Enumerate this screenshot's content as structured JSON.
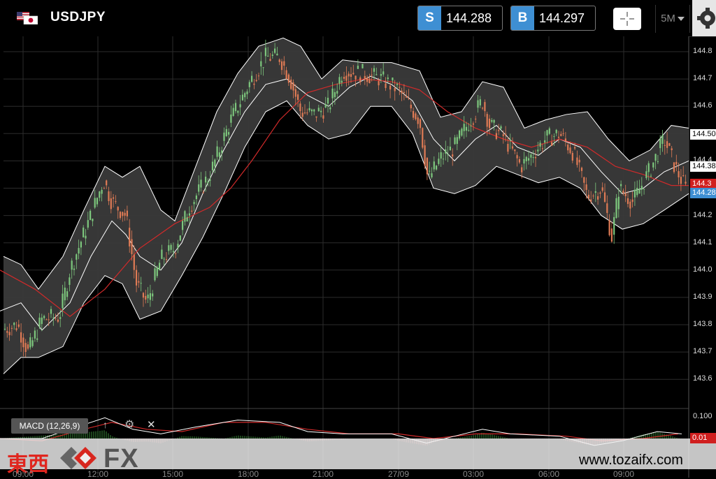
{
  "header": {
    "symbol": "USDJPY",
    "sell": {
      "tag": "S",
      "price": "144.288"
    },
    "buy": {
      "tag": "B",
      "price": "144.297"
    },
    "timeframe": "5M"
  },
  "price_badges": {
    "last": "144.50",
    "level2": "144.38",
    "red": "144.3",
    "blue": "144.28",
    "macd_red": "0.01"
  },
  "macd": {
    "label": "MACD (12,26,9)",
    "up_icon": "↑",
    "gear_icon": "⚙",
    "close_icon": "✕",
    "level_label": "0.100"
  },
  "watermark": {
    "kanji": "東西",
    "fx": "FX",
    "url": "www.tozaifx.com"
  },
  "colors": {
    "bull": "#7dc77d",
    "bear": "#e07b55",
    "band": "#ffffff",
    "ma": "#d02a2a",
    "badge_blue": "#3e8fd3"
  },
  "chart_data": {
    "type": "candlestick",
    "symbol": "USDJPY",
    "timeframe": "5M",
    "x_ticks": [
      "09:00",
      "12:00",
      "15:00",
      "18:00",
      "21:00",
      "27/09",
      "03:00",
      "06:00",
      "09:00"
    ],
    "y_ticks": [
      "144.8",
      "144.7",
      "144.6",
      "144.5",
      "144.4",
      "144.3",
      "144.2",
      "144.1",
      "144.0",
      "143.9",
      "143.8",
      "143.7",
      "143.6"
    ],
    "ylim": [
      143.55,
      144.85
    ],
    "grid": true,
    "price_series": [
      [
        0,
        143.78
      ],
      [
        25,
        143.8
      ],
      [
        40,
        143.7
      ],
      [
        60,
        143.82
      ],
      [
        85,
        143.83
      ],
      [
        100,
        144.0
      ],
      [
        130,
        144.2
      ],
      [
        148,
        144.33
      ],
      [
        160,
        144.25
      ],
      [
        180,
        144.2
      ],
      [
        195,
        143.95
      ],
      [
        210,
        143.88
      ],
      [
        230,
        144.04
      ],
      [
        250,
        144.08
      ],
      [
        270,
        144.23
      ],
      [
        300,
        144.35
      ],
      [
        330,
        144.55
      ],
      [
        360,
        144.7
      ],
      [
        380,
        144.78
      ],
      [
        400,
        144.78
      ],
      [
        415,
        144.7
      ],
      [
        430,
        144.58
      ],
      [
        450,
        144.57
      ],
      [
        470,
        144.6
      ],
      [
        490,
        144.73
      ],
      [
        520,
        144.72
      ],
      [
        545,
        144.7
      ],
      [
        570,
        144.66
      ],
      [
        600,
        144.55
      ],
      [
        612,
        144.33
      ],
      [
        630,
        144.41
      ],
      [
        650,
        144.45
      ],
      [
        670,
        144.54
      ],
      [
        690,
        144.62
      ],
      [
        700,
        144.53
      ],
      [
        720,
        144.49
      ],
      [
        745,
        144.38
      ],
      [
        760,
        144.42
      ],
      [
        780,
        144.48
      ],
      [
        800,
        144.5
      ],
      [
        820,
        144.43
      ],
      [
        840,
        144.27
      ],
      [
        860,
        144.3
      ],
      [
        875,
        144.12
      ],
      [
        885,
        144.3
      ],
      [
        905,
        144.25
      ],
      [
        930,
        144.37
      ],
      [
        950,
        144.48
      ],
      [
        965,
        144.38
      ],
      [
        980,
        144.3
      ]
    ],
    "ma_line": [
      [
        0,
        144.0
      ],
      [
        50,
        143.93
      ],
      [
        100,
        143.83
      ],
      [
        150,
        143.93
      ],
      [
        200,
        144.08
      ],
      [
        250,
        144.17
      ],
      [
        300,
        144.23
      ],
      [
        330,
        144.3
      ],
      [
        360,
        144.4
      ],
      [
        400,
        144.55
      ],
      [
        440,
        144.65
      ],
      [
        480,
        144.68
      ],
      [
        520,
        144.7
      ],
      [
        560,
        144.69
      ],
      [
        600,
        144.66
      ],
      [
        640,
        144.58
      ],
      [
        680,
        144.52
      ],
      [
        720,
        144.48
      ],
      [
        760,
        144.45
      ],
      [
        800,
        144.48
      ],
      [
        840,
        144.45
      ],
      [
        880,
        144.38
      ],
      [
        920,
        144.35
      ],
      [
        960,
        144.31
      ],
      [
        985,
        144.31
      ]
    ],
    "bb_mid": [
      [
        0,
        143.85
      ],
      [
        30,
        143.88
      ],
      [
        60,
        143.78
      ],
      [
        100,
        143.88
      ],
      [
        130,
        144.05
      ],
      [
        160,
        144.18
      ],
      [
        180,
        144.13
      ],
      [
        200,
        144.05
      ],
      [
        230,
        144.0
      ],
      [
        260,
        144.1
      ],
      [
        290,
        144.28
      ],
      [
        320,
        144.44
      ],
      [
        350,
        144.58
      ],
      [
        380,
        144.68
      ],
      [
        410,
        144.7
      ],
      [
        440,
        144.64
      ],
      [
        470,
        144.6
      ],
      [
        500,
        144.67
      ],
      [
        530,
        144.71
      ],
      [
        560,
        144.68
      ],
      [
        590,
        144.62
      ],
      [
        620,
        144.48
      ],
      [
        650,
        144.4
      ],
      [
        680,
        144.48
      ],
      [
        710,
        144.53
      ],
      [
        740,
        144.45
      ],
      [
        770,
        144.42
      ],
      [
        800,
        144.48
      ],
      [
        830,
        144.45
      ],
      [
        860,
        144.36
      ],
      [
        890,
        144.28
      ],
      [
        920,
        144.3
      ],
      [
        950,
        144.36
      ],
      [
        985,
        144.4
      ]
    ],
    "bb_upper": [
      [
        5,
        144.05
      ],
      [
        30,
        144.02
      ],
      [
        55,
        143.93
      ],
      [
        90,
        144.05
      ],
      [
        120,
        144.22
      ],
      [
        150,
        144.38
      ],
      [
        175,
        144.34
      ],
      [
        200,
        144.38
      ],
      [
        230,
        144.22
      ],
      [
        250,
        144.18
      ],
      [
        280,
        144.38
      ],
      [
        310,
        144.58
      ],
      [
        340,
        144.72
      ],
      [
        370,
        144.82
      ],
      [
        405,
        144.85
      ],
      [
        430,
        144.82
      ],
      [
        460,
        144.7
      ],
      [
        490,
        144.77
      ],
      [
        520,
        144.76
      ],
      [
        560,
        144.76
      ],
      [
        600,
        144.73
      ],
      [
        630,
        144.56
      ],
      [
        660,
        144.58
      ],
      [
        690,
        144.69
      ],
      [
        720,
        144.67
      ],
      [
        750,
        144.52
      ],
      [
        780,
        144.55
      ],
      [
        810,
        144.57
      ],
      [
        840,
        144.58
      ],
      [
        870,
        144.48
      ],
      [
        900,
        144.4
      ],
      [
        930,
        144.44
      ],
      [
        960,
        144.53
      ],
      [
        985,
        144.52
      ]
    ],
    "bb_lower": [
      [
        5,
        143.62
      ],
      [
        30,
        143.68
      ],
      [
        55,
        143.68
      ],
      [
        90,
        143.72
      ],
      [
        120,
        143.88
      ],
      [
        150,
        143.98
      ],
      [
        175,
        143.95
      ],
      [
        200,
        143.82
      ],
      [
        230,
        143.85
      ],
      [
        260,
        143.98
      ],
      [
        290,
        144.12
      ],
      [
        320,
        144.28
      ],
      [
        350,
        144.45
      ],
      [
        380,
        144.58
      ],
      [
        410,
        144.62
      ],
      [
        440,
        144.53
      ],
      [
        470,
        144.48
      ],
      [
        500,
        144.5
      ],
      [
        530,
        144.6
      ],
      [
        560,
        144.6
      ],
      [
        590,
        144.5
      ],
      [
        620,
        144.3
      ],
      [
        650,
        144.28
      ],
      [
        680,
        144.31
      ],
      [
        710,
        144.38
      ],
      [
        740,
        144.35
      ],
      [
        770,
        144.32
      ],
      [
        800,
        144.34
      ],
      [
        830,
        144.3
      ],
      [
        860,
        144.2
      ],
      [
        890,
        144.15
      ],
      [
        920,
        144.17
      ],
      [
        950,
        144.22
      ],
      [
        985,
        144.28
      ]
    ],
    "macd_line": [
      [
        0,
        0.0
      ],
      [
        60,
        0.0
      ],
      [
        120,
        0.06
      ],
      [
        150,
        0.09
      ],
      [
        190,
        0.04
      ],
      [
        230,
        0.02
      ],
      [
        280,
        0.05
      ],
      [
        340,
        0.08
      ],
      [
        400,
        0.07
      ],
      [
        440,
        0.03
      ],
      [
        490,
        0.02
      ],
      [
        560,
        0.02
      ],
      [
        610,
        -0.02
      ],
      [
        650,
        0.01
      ],
      [
        690,
        0.04
      ],
      [
        730,
        0.02
      ],
      [
        800,
        0.01
      ],
      [
        850,
        -0.03
      ],
      [
        890,
        -0.01
      ],
      [
        940,
        0.03
      ],
      [
        975,
        0.02
      ]
    ],
    "macd_signal": [
      [
        0,
        0.0
      ],
      [
        60,
        -0.01
      ],
      [
        120,
        0.04
      ],
      [
        160,
        0.07
      ],
      [
        210,
        0.04
      ],
      [
        260,
        0.03
      ],
      [
        320,
        0.07
      ],
      [
        380,
        0.07
      ],
      [
        440,
        0.04
      ],
      [
        500,
        0.02
      ],
      [
        570,
        0.02
      ],
      [
        620,
        0.0
      ],
      [
        680,
        0.02
      ],
      [
        740,
        0.02
      ],
      [
        810,
        0.01
      ],
      [
        860,
        -0.01
      ],
      [
        920,
        0.0
      ],
      [
        970,
        0.02
      ]
    ]
  }
}
